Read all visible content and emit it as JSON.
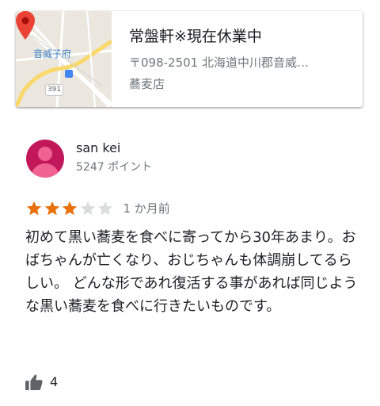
{
  "place": {
    "title": "常盤軒※現在休業中",
    "address": "〒098-2501 北海道中川郡音威…",
    "category": "蕎麦店",
    "map_label": "音威子府",
    "route_number": "391"
  },
  "review": {
    "reviewer_name": "san kei",
    "reviewer_points": "5247 ポイント",
    "rating": 3,
    "max_rating": 5,
    "date": "1 か月前",
    "text": "初めて黒い蕎麦を食べに寄ってから30年あまり。おばちゃんが亡くなり、おじちゃんも体調崩してるらしい。 どんな形であれ復活する事があれば同じような黒い蕎麦を食べに行きたいものです。",
    "like_count": "4"
  },
  "colors": {
    "star_filled": "#e8710a",
    "star_empty": "#dadce0",
    "avatar_bg": "#c2185b",
    "pin": "#ea4335"
  }
}
